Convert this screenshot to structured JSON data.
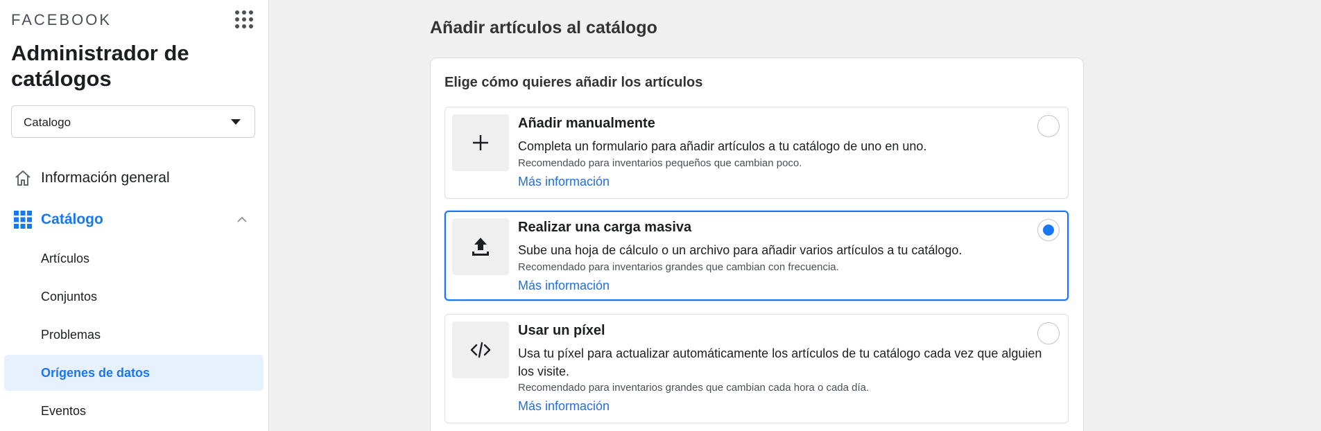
{
  "sidebar": {
    "brand": "FACEBOOK",
    "app_title": "Administrador de catálogos",
    "catalog_select": {
      "value": "Catalogo"
    },
    "nav": [
      {
        "label": "Información general",
        "icon": "home-icon"
      },
      {
        "label": "Catálogo",
        "icon": "grid-icon",
        "expanded": true
      }
    ],
    "sub_items": [
      {
        "label": "Artículos",
        "active": false
      },
      {
        "label": "Conjuntos",
        "active": false
      },
      {
        "label": "Problemas",
        "active": false
      },
      {
        "label": "Orígenes de datos",
        "active": true
      },
      {
        "label": "Eventos",
        "active": false
      }
    ]
  },
  "main": {
    "page_title": "Añadir artículos al catálogo",
    "card_title": "Elige cómo quieres añadir los artículos",
    "options": [
      {
        "title": "Añadir manualmente",
        "description": "Completa un formulario para añadir artículos a tu catálogo de uno en uno.",
        "recommendation": "Recomendado para inventarios pequeños que cambian poco.",
        "link": "Más información",
        "icon": "plus-icon",
        "selected": false
      },
      {
        "title": "Realizar una carga masiva",
        "description": "Sube una hoja de cálculo o un archivo para añadir varios artículos a tu catálogo.",
        "recommendation": "Recomendado para inventarios grandes que cambian con frecuencia.",
        "link": "Más información",
        "icon": "upload-icon",
        "selected": true
      },
      {
        "title": "Usar un píxel",
        "description": "Usa tu píxel para actualizar automáticamente los artículos de tu catálogo cada vez que alguien los visite.",
        "recommendation": "Recomendado para inventarios grandes que cambian cada hora o cada día.",
        "link": "Más información",
        "icon": "code-icon",
        "selected": false
      }
    ]
  },
  "colors": {
    "accent": "#1877f2",
    "link": "#216fdb",
    "active_bg": "#e7f0fd",
    "page_bg": "#f0f0f0"
  }
}
